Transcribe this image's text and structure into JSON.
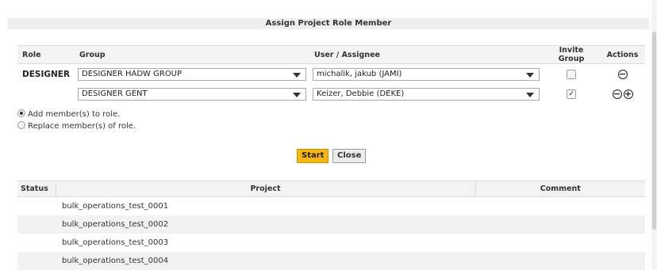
{
  "dialog": {
    "title": "Assign Project Role Member"
  },
  "roles_table": {
    "headers": {
      "role": "Role",
      "group": "Group",
      "user": "User / Assignee",
      "invite": "Invite Group",
      "actions": "Actions"
    },
    "rows": [
      {
        "role": "DESIGNER",
        "group": "DESIGNER HADW GROUP",
        "user": "michalik, jakub (JAMI)",
        "invite_checked": false,
        "actions": [
          "remove"
        ]
      },
      {
        "role": "",
        "group": "DESIGNER GENT",
        "user": "Keizer, Debbie (DEKE)",
        "invite_checked": true,
        "actions": [
          "remove",
          "add"
        ]
      }
    ]
  },
  "options": {
    "add_label": "Add member(s) to role.",
    "replace_label": "Replace member(s) of role.",
    "selected": "add"
  },
  "buttons": {
    "start": "Start",
    "close": "Close"
  },
  "results_table": {
    "headers": {
      "status": "Status",
      "project": "Project",
      "comment": "Comment"
    },
    "rows": [
      {
        "status": "",
        "project": "bulk_operations_test_0001",
        "comment": ""
      },
      {
        "status": "",
        "project": "bulk_operations_test_0002",
        "comment": ""
      },
      {
        "status": "",
        "project": "bulk_operations_test_0003",
        "comment": ""
      },
      {
        "status": "",
        "project": "bulk_operations_test_0004",
        "comment": ""
      }
    ]
  },
  "icons": {
    "minus": "circle-minus-icon",
    "plus": "circle-plus-icon",
    "check": "checkmark-icon"
  },
  "colors": {
    "start_button": "#f7b70e",
    "header_bg": "#f3f3f3",
    "alt_row": "#f2f2f2"
  }
}
